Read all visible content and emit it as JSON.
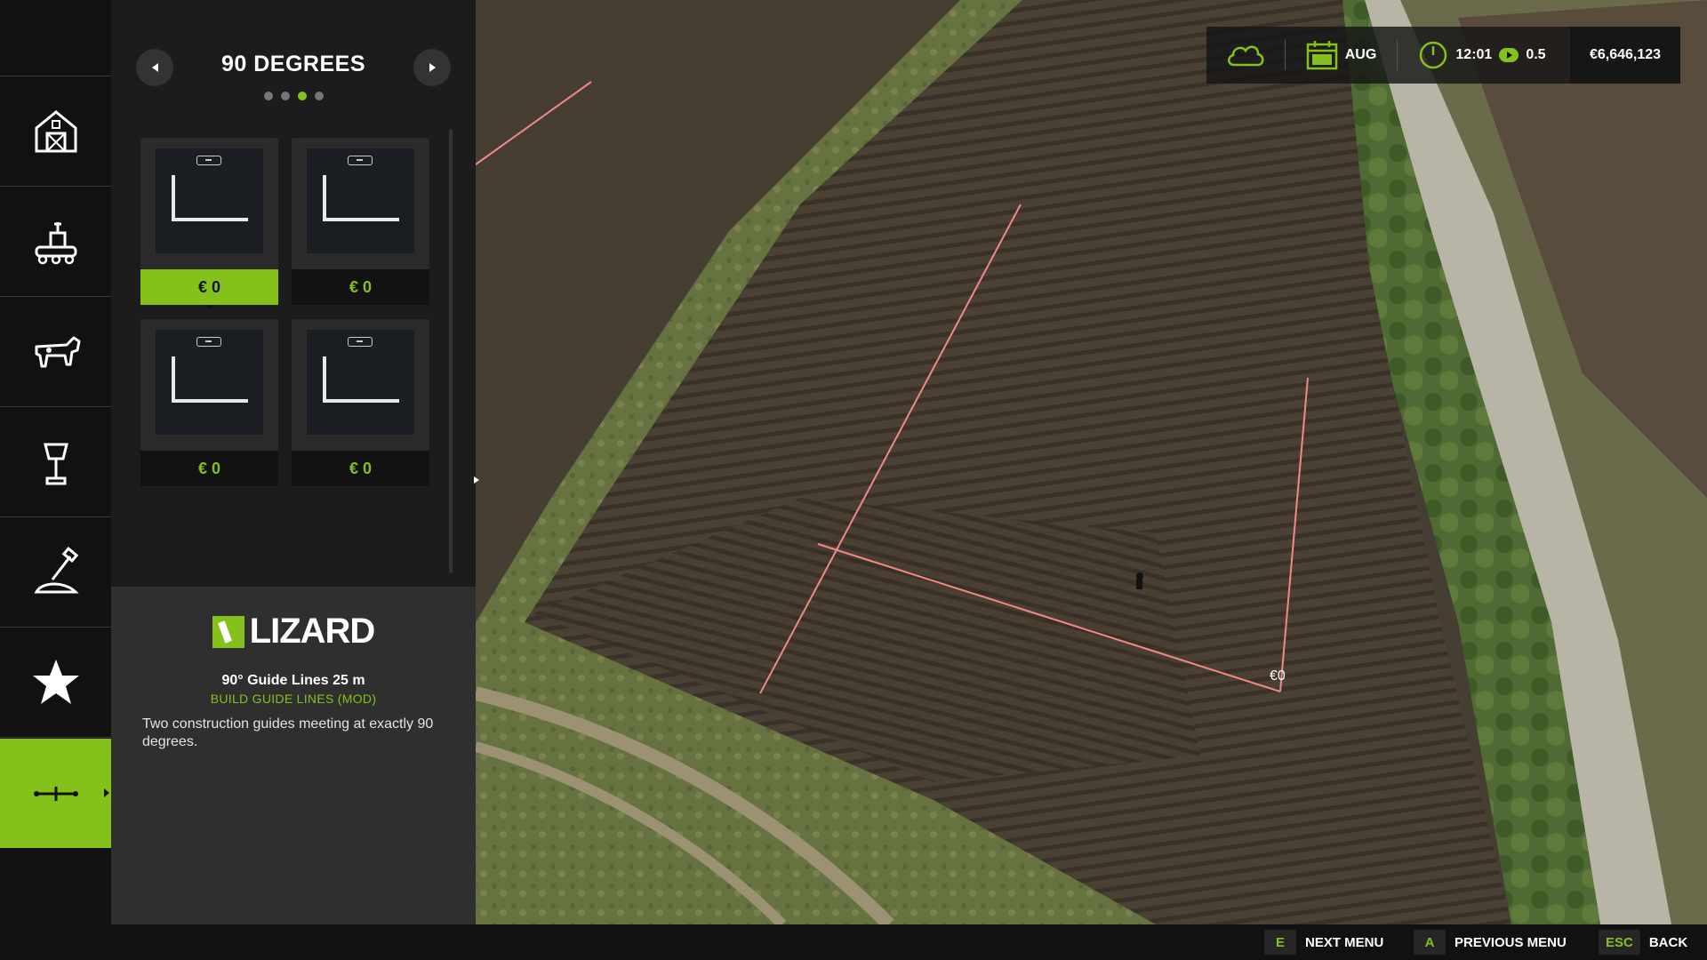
{
  "colors": {
    "accent": "#84c21b",
    "panel": "#1c1c1c",
    "guide_line": "#f08a86"
  },
  "sidebar": {
    "items": [
      {
        "name": "farm-buildings",
        "icon": "barn-icon"
      },
      {
        "name": "production",
        "icon": "factory-icon"
      },
      {
        "name": "animals",
        "icon": "cow-icon"
      },
      {
        "name": "decorations",
        "icon": "lamp-icon"
      },
      {
        "name": "landscaping",
        "icon": "shovel-icon"
      },
      {
        "name": "favorites",
        "icon": "star-icon"
      },
      {
        "name": "guide-lines",
        "icon": "guide-lines-icon",
        "active": true
      }
    ]
  },
  "panel": {
    "category_title": "90 DEGREES",
    "page_dots": 4,
    "active_page": 3,
    "cards": [
      {
        "price": "€ 0",
        "selected": true
      },
      {
        "price": "€ 0",
        "selected": false
      },
      {
        "price": "€ 0",
        "selected": false
      },
      {
        "price": "€ 0",
        "selected": false
      }
    ]
  },
  "info": {
    "brand": "LIZARD",
    "item_name": "90° Guide Lines 25 m",
    "mod_label": "BUILD GUIDE LINES (MOD)",
    "description": "Two construction guides meeting at exactly 90 degrees."
  },
  "hud": {
    "weather_icon": "cloud-icon",
    "calendar_icon": "calendar-icon",
    "month": "AUG",
    "clock_icon": "clock-icon",
    "time": "12:01",
    "speed_icon": "play-icon",
    "time_scale": "0.5",
    "money": "€6,646,123"
  },
  "world": {
    "placement_price": "€0"
  },
  "bottom_bar": [
    {
      "key": "E",
      "label": "NEXT MENU"
    },
    {
      "key": "A",
      "label": "PREVIOUS MENU"
    },
    {
      "key": "ESC",
      "label": "BACK"
    }
  ]
}
